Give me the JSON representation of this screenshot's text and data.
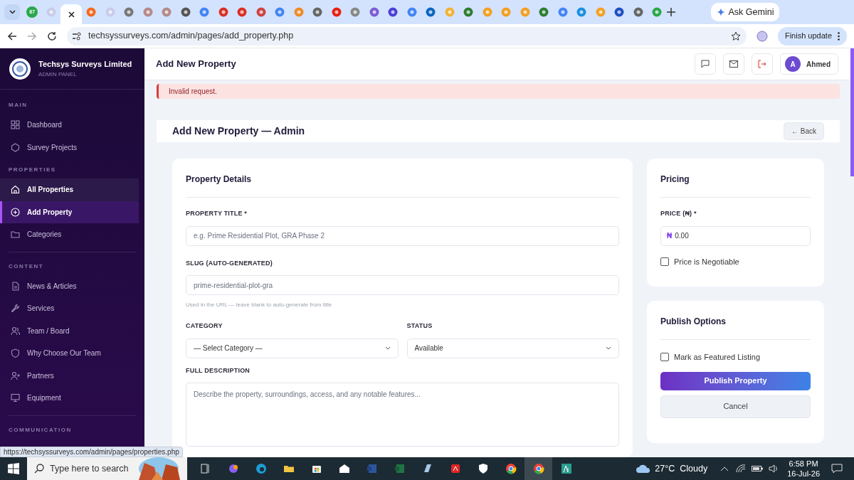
{
  "browser": {
    "tabs": [
      {
        "selected": false,
        "badge": "87"
      },
      {
        "selected": false
      },
      {
        "selected": true
      },
      {
        "selected": false
      },
      {
        "selected": false
      },
      {
        "selected": false
      },
      {
        "selected": false
      },
      {
        "selected": false
      },
      {
        "selected": false
      },
      {
        "selected": false
      },
      {
        "selected": false
      },
      {
        "selected": false
      },
      {
        "selected": false
      },
      {
        "selected": false
      },
      {
        "selected": false
      },
      {
        "selected": false
      },
      {
        "selected": false
      },
      {
        "selected": false
      },
      {
        "selected": false
      },
      {
        "selected": false
      },
      {
        "selected": false
      },
      {
        "selected": false
      },
      {
        "selected": false
      },
      {
        "selected": false
      },
      {
        "selected": false
      },
      {
        "selected": false
      },
      {
        "selected": false
      },
      {
        "selected": false
      },
      {
        "selected": false
      },
      {
        "selected": false
      },
      {
        "selected": false
      },
      {
        "selected": false
      },
      {
        "selected": false
      },
      {
        "selected": false
      }
    ],
    "address": "techsyssurveys.com/admin/pages/add_property.php",
    "gemini": "Ask Gemini",
    "update": "Finish update",
    "status_url": "https://techsyssurveys.com/admin/pages/properties.php"
  },
  "sidebar": {
    "brand": "Techsys Surveys Limited",
    "subtitle": "ADMIN PANEL",
    "sections": [
      {
        "heading": "MAIN",
        "items": [
          {
            "label": "Dashboard",
            "selected": false,
            "hovered": false
          },
          {
            "label": "Survey Projects",
            "selected": false,
            "hovered": false
          }
        ]
      },
      {
        "heading": "PROPERTIES",
        "items": [
          {
            "label": "All Properties",
            "selected": false,
            "hovered": true
          },
          {
            "label": "Add Property",
            "selected": true,
            "hovered": false
          },
          {
            "label": "Categories",
            "selected": false,
            "hovered": false
          }
        ]
      },
      {
        "heading": "CONTENT",
        "items": [
          {
            "label": "News & Articles",
            "selected": false,
            "hovered": false
          },
          {
            "label": "Services",
            "selected": false,
            "hovered": false
          },
          {
            "label": "Team / Board",
            "selected": false,
            "hovered": false
          },
          {
            "label": "Why Choose Our Team",
            "selected": false,
            "hovered": false
          },
          {
            "label": "Partners",
            "selected": false,
            "hovered": false
          },
          {
            "label": "Equipment",
            "selected": false,
            "hovered": false
          }
        ]
      },
      {
        "heading": "COMMUNICATION"
      }
    ]
  },
  "topbar": {
    "title": "Add New Property",
    "avatar": "A",
    "user": "Ahmed"
  },
  "alert": "Invalid request.",
  "header": {
    "title": "Add New Property — Admin",
    "back": "← Back"
  },
  "details": {
    "title": "Property Details",
    "property_title": {
      "label": "PROPERTY TITLE",
      "required_mark": "*",
      "placeholder": "e.g. Prime Residential Plot, GRA Phase 2"
    },
    "slug": {
      "label": "SLUG (AUTO-GENERATED)",
      "placeholder": "prime-residential-plot-gra",
      "hint": "Used in the URL — leave blank to auto-generate from title"
    },
    "category": {
      "label": "CATEGORY",
      "value": "— Select Category —"
    },
    "status": {
      "label": "STATUS",
      "value": "Available"
    },
    "description": {
      "label": "FULL DESCRIPTION",
      "placeholder": "Describe the property, surroundings, access, and any notable features..."
    }
  },
  "pricing": {
    "title": "Pricing",
    "label": "PRICE (₦)",
    "required_mark": "*",
    "prefix": "₦",
    "placeholder": "0.00",
    "negotiable": {
      "label": "Price is Negotiable",
      "checked": false
    }
  },
  "publish": {
    "title": "Publish Options",
    "featured": {
      "label": "Mark as Featured Listing",
      "checked": false
    },
    "submit": "Publish Property",
    "cancel": "Cancel"
  },
  "taskbar": {
    "search": "Type here to search",
    "weather": "27°C  Cloudy",
    "time": "6:58 PM",
    "date": "16-Jul-26"
  }
}
